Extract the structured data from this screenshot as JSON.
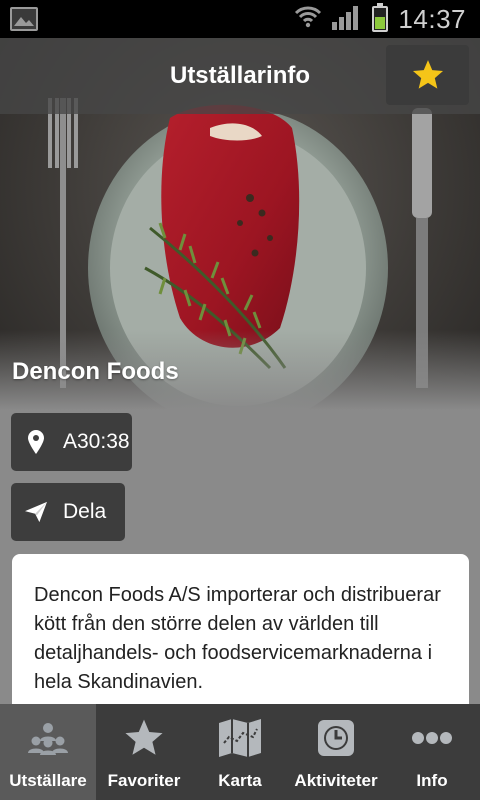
{
  "statusbar": {
    "time": "14:37",
    "battery_level": 0.55,
    "icons": [
      "gallery-icon",
      "wifi-icon",
      "signal-icon",
      "battery-icon"
    ]
  },
  "header": {
    "title": "Utställarinfo",
    "favorite_icon": "star-icon",
    "favorite_color": "#f5c518"
  },
  "exhibitor": {
    "name": "Dencon Foods",
    "location": "A30:38",
    "share_label": "Dela",
    "description": "Dencon Foods A/S importerar och distribuerar kött från den större delen av världen till detaljhandels- och foodservicemarknaderna i hela Skandinavien."
  },
  "nav": {
    "items": [
      {
        "label": "Utställare",
        "icon": "exhibitors-icon",
        "active": true
      },
      {
        "label": "Favoriter",
        "icon": "star-icon",
        "active": false
      },
      {
        "label": "Karta",
        "icon": "map-icon",
        "active": false
      },
      {
        "label": "Aktiviteter",
        "icon": "clock-icon",
        "active": false
      },
      {
        "label": "Info",
        "icon": "more-icon",
        "active": false
      }
    ]
  },
  "colors": {
    "appbar": "#464646",
    "background": "#8a8a8a",
    "nav_bg": "#3c3c3c",
    "nav_active": "#5a5a5a",
    "pill": "#3d3d3d",
    "battery": "#8cc83c"
  }
}
